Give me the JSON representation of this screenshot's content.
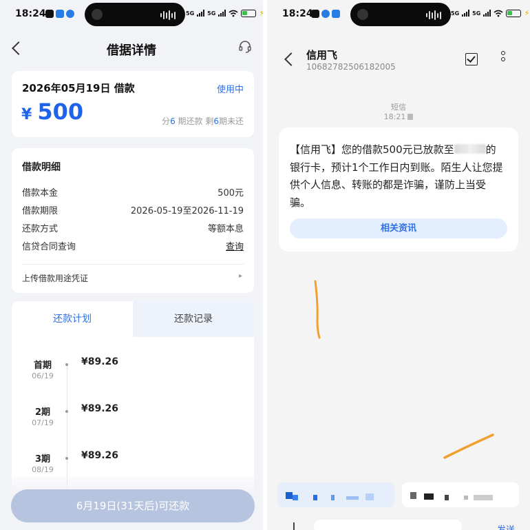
{
  "left": {
    "status": {
      "time": "18:24",
      "net1": "5G",
      "net2": "5G"
    },
    "header": {
      "title": "借据详情"
    },
    "loan": {
      "date_label": "2026年05月19日 借款",
      "status": "使用中",
      "currency": "¥",
      "amount": "500",
      "period_prefix": "分",
      "period_total": "6",
      "period_mid": " 期还款 剩",
      "period_remaining": "6",
      "period_suffix": "期未还"
    },
    "detail": {
      "title": "借款明细",
      "rows": [
        {
          "key": "借款本金",
          "value": "500元"
        },
        {
          "key": "借款期限",
          "value": "2026-05-19至2026-11-19"
        },
        {
          "key": "还款方式",
          "value": "等额本息"
        },
        {
          "key": "信贷合同查询",
          "value": "查询"
        }
      ],
      "upload": "上传借款用途凭证",
      "upload_chevron": "▸"
    },
    "tabs": {
      "active": "还款计划",
      "inactive": "还款记录"
    },
    "plan": [
      {
        "label": "首期",
        "date": "06/19",
        "amount": "¥89.26"
      },
      {
        "label": "2期",
        "date": "07/19",
        "amount": "¥89.26"
      },
      {
        "label": "3期",
        "date": "08/19",
        "amount": "¥89.26"
      }
    ],
    "button": "6月19日(31天后)可还款"
  },
  "right": {
    "status": {
      "time": "18:24",
      "net1": "5G",
      "net2": "5G"
    },
    "sender": {
      "name": "信用飞",
      "number": "10682782506182005"
    },
    "message_meta": {
      "type": "短信",
      "time": "18:21"
    },
    "message": {
      "part1": "【信用飞】您的借款500元已放款至",
      "part2": "的银行卡，预计1个工作日内到账。陌生人让您提供个人信息、转账的都是诈骗，谨防上当受骗。"
    },
    "news_button": "相关资讯",
    "composer": {
      "send": "发送"
    }
  },
  "colors": {
    "accent": "#2f6fe6",
    "amount": "#1e63e9",
    "button_disabled": "#b7c4df",
    "annotation": "#f0a030"
  },
  "icons": [
    "back-arrow-icon",
    "headset-icon",
    "checkbox-icon",
    "more-icon",
    "sim-card-icon"
  ]
}
